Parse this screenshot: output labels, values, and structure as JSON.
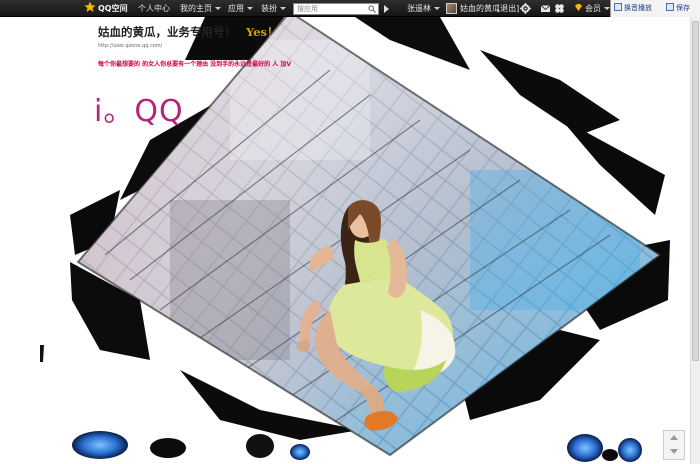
{
  "topbar": {
    "logo_label": "QQ空间",
    "nav": [
      {
        "label": "个人中心"
      },
      {
        "label": "我的主页"
      },
      {
        "label": "应用"
      },
      {
        "label": "装扮"
      }
    ],
    "search_placeholder": "搜应用",
    "username": "张遥林",
    "profile_name": "姑血的黄瓜",
    "logout_label": "[退出]",
    "vip_label": "会员",
    "right_buttons": [
      {
        "label": "换音播放"
      },
      {
        "label": "保存"
      }
    ],
    "colors": {
      "bar_bg": "#1f1f1f",
      "accent": "#f5b800"
    }
  },
  "blog": {
    "title": "姑血的黄瓜，业务专用号！",
    "title_suffix": "Yes！",
    "url": "http://user.qzone.qq.com/",
    "description": "每个你最想要的  的女人你总要有一个理由  没到手的永远是最好的  人  加V",
    "big_text": "i。QQ",
    "accent_color": "#b5237f"
  },
  "icons": {
    "logo": "qzone-star-icon",
    "search": "search-icon",
    "play": "play-icon",
    "settings": "gear-icon",
    "mail": "mail-icon",
    "apps": "clover-icon",
    "vip": "diamond-icon"
  }
}
